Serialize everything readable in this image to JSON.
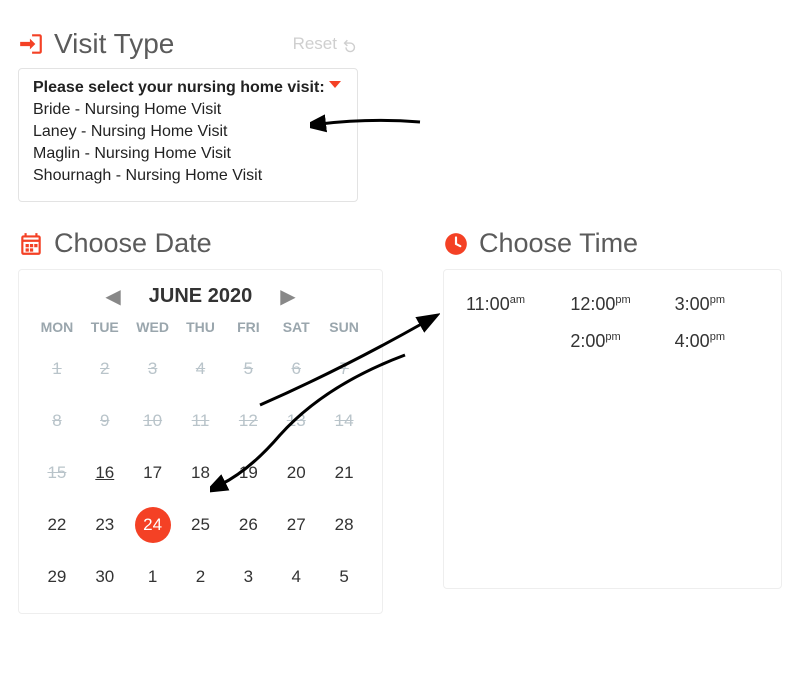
{
  "visitType": {
    "title": "Visit Type",
    "reset": "Reset",
    "prompt": "Please select your nursing home visit:",
    "options": [
      "Bride - Nursing Home Visit",
      "Laney - Nursing Home Visit",
      "Maglin - Nursing Home Visit",
      "Shournagh - Nursing Home Visit"
    ]
  },
  "date": {
    "title": "Choose Date",
    "month": "JUNE 2020",
    "dow": [
      "MON",
      "TUE",
      "WED",
      "THU",
      "FRI",
      "SAT",
      "SUN"
    ],
    "cells": [
      {
        "n": "1",
        "state": "disabled"
      },
      {
        "n": "2",
        "state": "disabled"
      },
      {
        "n": "3",
        "state": "disabled"
      },
      {
        "n": "4",
        "state": "disabled"
      },
      {
        "n": "5",
        "state": "disabled"
      },
      {
        "n": "6",
        "state": "disabled"
      },
      {
        "n": "7",
        "state": "disabled"
      },
      {
        "n": "8",
        "state": "disabled"
      },
      {
        "n": "9",
        "state": "disabled"
      },
      {
        "n": "10",
        "state": "disabled"
      },
      {
        "n": "11",
        "state": "disabled"
      },
      {
        "n": "12",
        "state": "disabled"
      },
      {
        "n": "13",
        "state": "disabled"
      },
      {
        "n": "14",
        "state": "disabled"
      },
      {
        "n": "15",
        "state": "disabled"
      },
      {
        "n": "16",
        "state": "today"
      },
      {
        "n": "17",
        "state": ""
      },
      {
        "n": "18",
        "state": ""
      },
      {
        "n": "19",
        "state": ""
      },
      {
        "n": "20",
        "state": ""
      },
      {
        "n": "21",
        "state": ""
      },
      {
        "n": "22",
        "state": ""
      },
      {
        "n": "23",
        "state": ""
      },
      {
        "n": "24",
        "state": "selected"
      },
      {
        "n": "25",
        "state": ""
      },
      {
        "n": "26",
        "state": ""
      },
      {
        "n": "27",
        "state": ""
      },
      {
        "n": "28",
        "state": ""
      },
      {
        "n": "29",
        "state": ""
      },
      {
        "n": "30",
        "state": ""
      },
      {
        "n": "1",
        "state": ""
      },
      {
        "n": "2",
        "state": ""
      },
      {
        "n": "3",
        "state": ""
      },
      {
        "n": "4",
        "state": ""
      },
      {
        "n": "5",
        "state": ""
      }
    ]
  },
  "time": {
    "title": "Choose Time",
    "slots": [
      {
        "t": "11:00",
        "p": "am"
      },
      {
        "t": "12:00",
        "p": "pm"
      },
      {
        "t": "3:00",
        "p": "pm"
      },
      {
        "t": "",
        "p": ""
      },
      {
        "t": "2:00",
        "p": "pm"
      },
      {
        "t": "4:00",
        "p": "pm"
      }
    ]
  }
}
